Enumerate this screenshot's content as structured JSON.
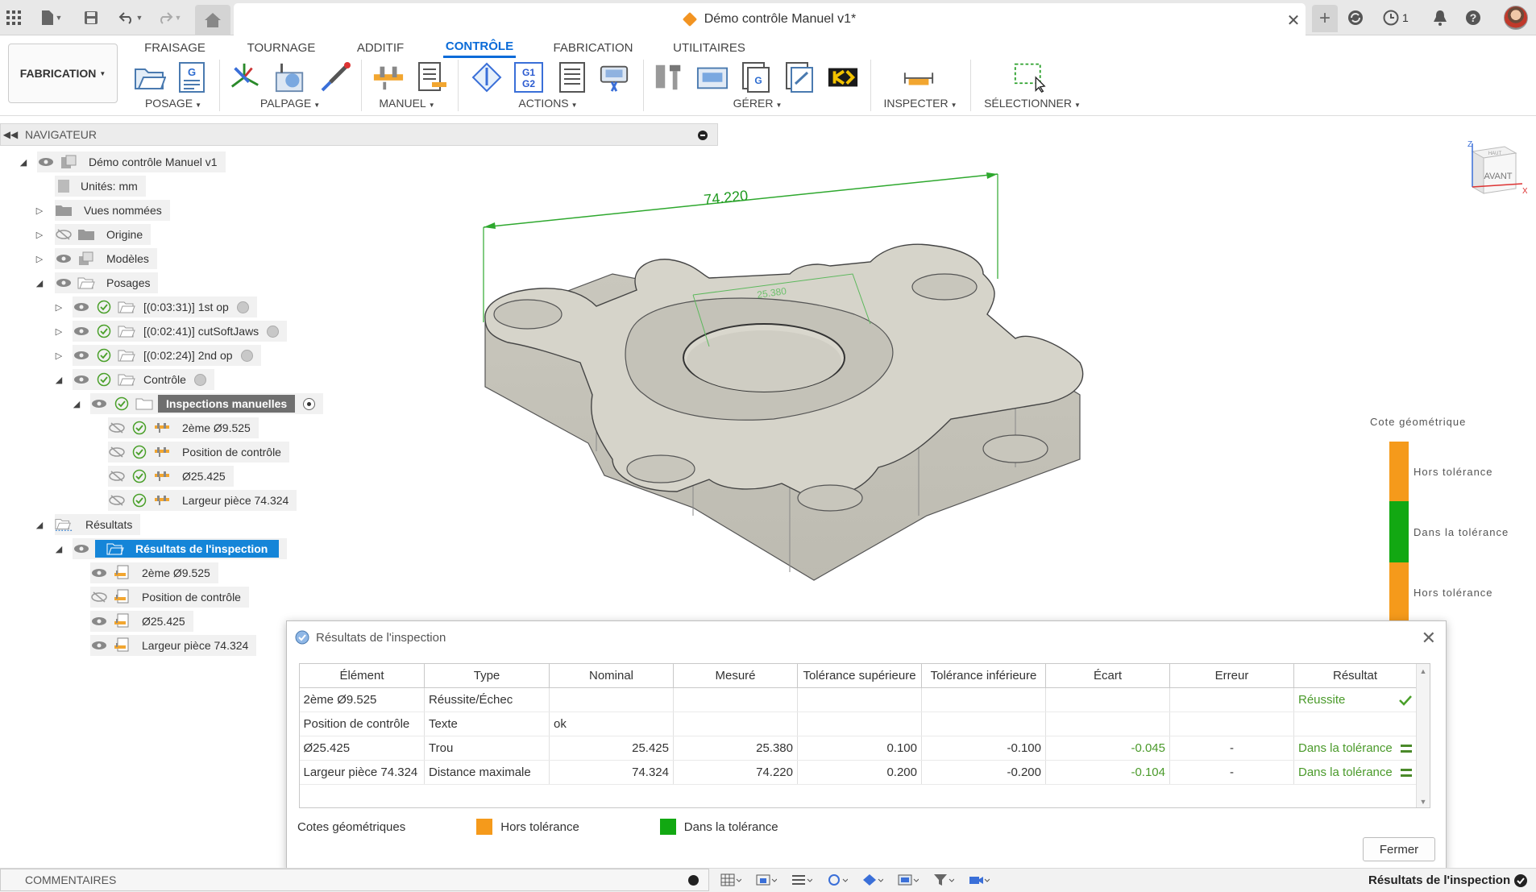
{
  "title_bar": {
    "document_title": "Démo contrôle Manuel v1*",
    "notification_count": "1"
  },
  "workspace": {
    "label": "FABRICATION"
  },
  "ribbon": {
    "tabs": [
      {
        "label": "FRAISAGE",
        "active": false
      },
      {
        "label": "TOURNAGE",
        "active": false
      },
      {
        "label": "ADDITIF",
        "active": false
      },
      {
        "label": "CONTRÔLE",
        "active": true
      },
      {
        "label": "FABRICATION",
        "active": false
      },
      {
        "label": "UTILITAIRES",
        "active": false
      }
    ],
    "groups": [
      "POSAGE",
      "PALPAGE",
      "MANUEL",
      "ACTIONS",
      "GÉRER",
      "INSPECTER",
      "SÉLECTIONNER"
    ],
    "gcode_label_top": "G1",
    "gcode_label_bottom": "G2"
  },
  "navigator": {
    "header": "NAVIGATEUR",
    "items": [
      {
        "label": "Démo contrôle Manuel v1"
      },
      {
        "label": "Unités: mm"
      },
      {
        "label": "Vues nommées"
      },
      {
        "label": "Origine"
      },
      {
        "label": "Modèles"
      },
      {
        "label": "Posages"
      },
      {
        "label": "[(0:03:31)] 1st op"
      },
      {
        "label": "[(0:02:41)] cutSoftJaws"
      },
      {
        "label": "[(0:02:24)] 2nd op"
      },
      {
        "label": "Contrôle"
      },
      {
        "label": "Inspections manuelles"
      },
      {
        "label": "2ème Ø9.525"
      },
      {
        "label": "Position de contrôle"
      },
      {
        "label": "Ø25.425"
      },
      {
        "label": "Largeur pièce 74.324"
      },
      {
        "label": "Résultats"
      },
      {
        "label": "Résultats de l'inspection"
      },
      {
        "label": "2ème Ø9.525"
      },
      {
        "label": "Position de contrôle"
      },
      {
        "label": "Ø25.425"
      },
      {
        "label": "Largeur pièce 74.324"
      }
    ]
  },
  "viewport": {
    "dimension_main": "74.220",
    "dimension_hole": "25.380",
    "viewcube_face": "AVANT",
    "viewcube_top": "HAUT",
    "axis_z": "Z",
    "axis_x": "X"
  },
  "legend": {
    "title": "Cote géométrique",
    "items": [
      {
        "label": "Hors tolérance",
        "color": "#f59a1b"
      },
      {
        "label": "Dans la tolérance",
        "color": "#12a812"
      },
      {
        "label": "Hors tolérance",
        "color": "#f59a1b"
      }
    ]
  },
  "dialog": {
    "title": "Résultats de l'inspection",
    "columns": [
      "Élément",
      "Type",
      "Nominal",
      "Mesuré",
      "Tolérance supérieure",
      "Tolérance inférieure",
      "Écart",
      "Erreur",
      "Résultat"
    ],
    "rows": [
      {
        "element": "2ème Ø9.525",
        "type": "Réussite/Échec",
        "nominal": "",
        "measured": "",
        "tol_sup": "",
        "tol_inf": "",
        "deviation": "",
        "error": "",
        "result": "Réussite",
        "result_icon": "check-icon"
      },
      {
        "element": "Position de contrôle",
        "type": "Texte",
        "nominal": "ok",
        "measured": "",
        "tol_sup": "",
        "tol_inf": "",
        "deviation": "",
        "error": "",
        "result": "",
        "result_icon": ""
      },
      {
        "element": "Ø25.425",
        "type": "Trou",
        "nominal": "25.425",
        "measured": "25.380",
        "tol_sup": "0.100",
        "tol_inf": "-0.100",
        "deviation": "-0.045",
        "error": "-",
        "result": "Dans la tolérance",
        "result_icon": "equal-icon"
      },
      {
        "element": "Largeur pièce 74.324",
        "type": "Distance maximale",
        "nominal": "74.324",
        "measured": "74.220",
        "tol_sup": "0.200",
        "tol_inf": "-0.200",
        "deviation": "-0.104",
        "error": "-",
        "result": "Dans la tolérance",
        "result_icon": "equal-icon"
      }
    ],
    "legend_title": "Cotes géométriques",
    "legend_out": "Hors tolérance",
    "legend_in": "Dans la tolérance",
    "out_color": "#f59a1b",
    "in_color": "#12a812",
    "close_label": "Fermer"
  },
  "bottom_bar": {
    "comments": "COMMENTAIRES",
    "status": "Résultats de l'inspection"
  }
}
